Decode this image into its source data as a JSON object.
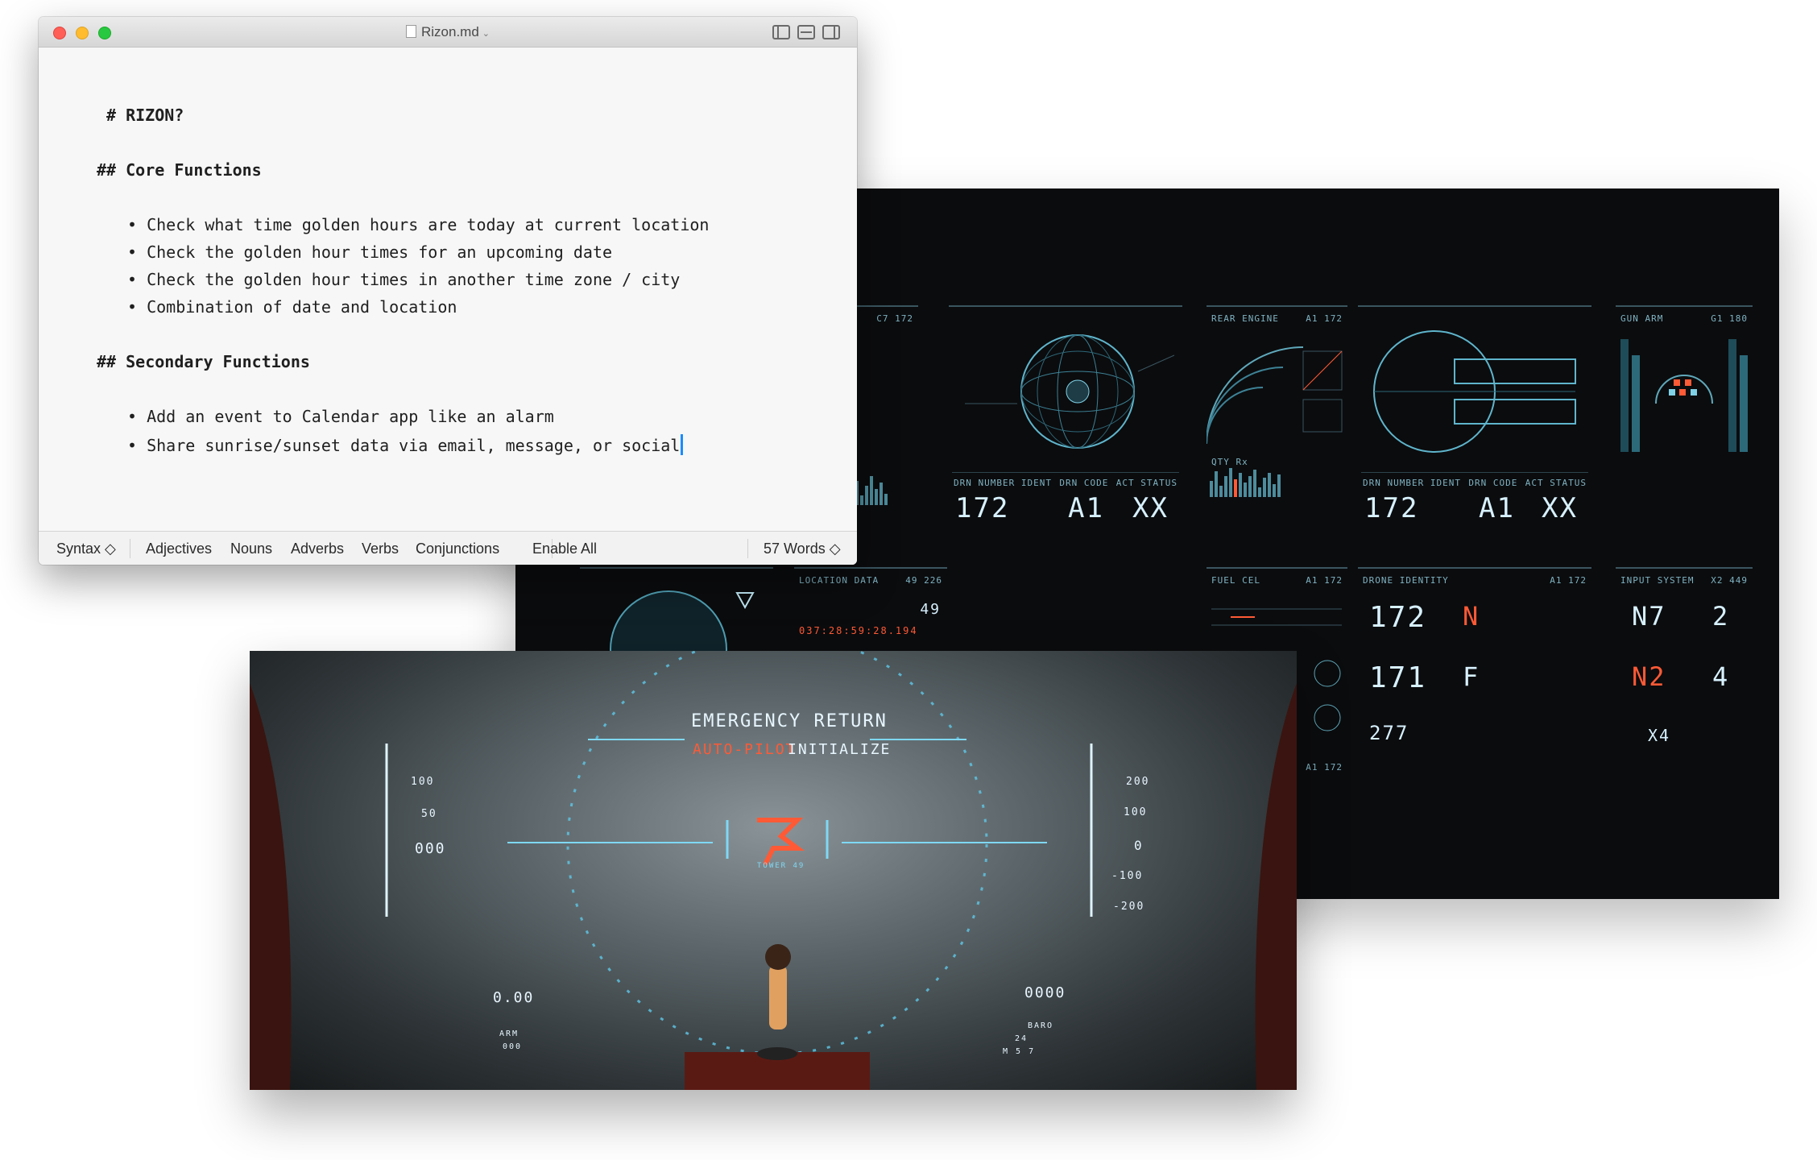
{
  "editor": {
    "title": "Rizon.md",
    "lines": {
      "h1": "# RIZON?",
      "h2a": "## Core Functions",
      "b1": "• Check what time golden hours are today at current location",
      "b2": "• Check the golden hour times for an upcoming date",
      "b3": "• Check the golden hour times in another time zone / city",
      "b4": "• Combination of date and location",
      "h2b": "## Secondary Functions",
      "b5": "• Add an event to Calendar app like an alarm",
      "b6": "• Share sunrise/sunset data via email, message, or social"
    },
    "statusbar": {
      "syntax": "Syntax ◇",
      "adjectives": "Adjectives",
      "nouns": "Nouns",
      "adverbs": "Adverbs",
      "verbs": "Verbs",
      "conjunctions": "Conjunctions",
      "enable_all": "Enable All",
      "word_count": "57 Words ◇"
    }
  },
  "dashboard": {
    "p1": {
      "l": "",
      "r": "C7  172",
      "n1": "172",
      "n2": "A1",
      "n3": "XX",
      "c1": "DRN NUMBER IDENT",
      "c2": "DRN CODE",
      "c3": "ACT STATUS"
    },
    "p2": {
      "l": "REAR ENGINE",
      "r": "A1  172",
      "sub": "QTY Rx"
    },
    "p3": {
      "l": "",
      "r": "",
      "n1": "172",
      "n2": "A1",
      "n3": "XX",
      "c1": "DRN NUMBER IDENT",
      "c2": "DRN CODE",
      "c3": "ACT STATUS"
    },
    "p4": {
      "l": "GUN ARM",
      "r": "G1  180"
    },
    "p5": {
      "l": "LOCATION DATA",
      "r": "49  226",
      "v": "49",
      "t": "037:28:59:28.194"
    },
    "p6": {
      "l": "FUEL CEL",
      "r": "A1  172",
      "f": "A1  172"
    },
    "p7": {
      "l": "DRONE IDENTITY",
      "r": "A1  172",
      "n1": "172",
      "n2": "171",
      "n3": "277"
    },
    "p8": {
      "l": "INPUT SYSTEM",
      "r": "X2  449",
      "n1": "N7",
      "n2": "2",
      "n3": "N2",
      "n4": "4",
      "n5": "X4"
    }
  },
  "hud": {
    "line1": "EMERGENCY RETURN",
    "line2a": "AUTO-PILOT",
    "line2b": "INITIALIZE",
    "tower": "TOWER 49",
    "left_scale": [
      "100",
      "50",
      "000"
    ],
    "right_scale": [
      "200",
      "100",
      "0",
      "-100",
      "-200"
    ],
    "left_readout": "0.00",
    "right_readout": "0000",
    "arm": "ARM",
    "arm_val": "000",
    "baro": "BARO",
    "baro_val": "24",
    "hm": "M  5  7"
  },
  "colors": {
    "red": "#ff5f57",
    "yellow": "#febc2e",
    "green": "#28c840",
    "accent": "#1a8cff",
    "hud_red": "#ff5a36"
  }
}
